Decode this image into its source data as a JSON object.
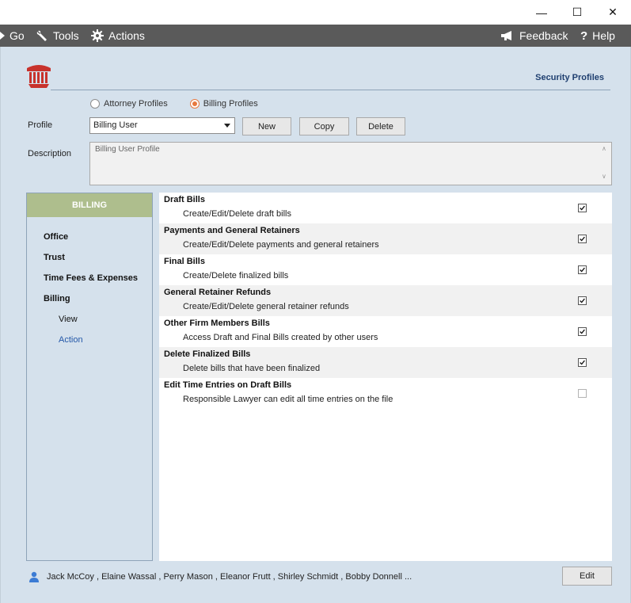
{
  "window": {
    "minimize_glyph": "—",
    "maximize_glyph": "☐",
    "close_glyph": "✕"
  },
  "menubar": {
    "go": "Go",
    "tools": "Tools",
    "actions": "Actions",
    "feedback": "Feedback",
    "help": "Help"
  },
  "header": {
    "section_title": "Security Profiles"
  },
  "profile_type": {
    "options": [
      "Attorney Profiles",
      "Billing Profiles"
    ],
    "selected": "Billing Profiles"
  },
  "form": {
    "profile_label": "Profile",
    "profile_value": "Billing User",
    "new_label": "New",
    "copy_label": "Copy",
    "delete_label": "Delete",
    "description_label": "Description",
    "description_value": "Billing User Profile"
  },
  "sidebar": {
    "header": "BILLING",
    "items": [
      {
        "label": "Office"
      },
      {
        "label": "Trust"
      },
      {
        "label": "Time Fees & Expenses"
      },
      {
        "label": "Billing"
      },
      {
        "label": "View"
      },
      {
        "label": "Action"
      }
    ]
  },
  "permissions": [
    {
      "title": "Draft Bills",
      "desc": "Create/Edit/Delete draft bills",
      "checked": true
    },
    {
      "title": "Payments and General Retainers",
      "desc": "Create/Edit/Delete payments and general retainers",
      "checked": true
    },
    {
      "title": "Final Bills",
      "desc": "Create/Delete finalized bills",
      "checked": true
    },
    {
      "title": "General Retainer Refunds",
      "desc": "Create/Edit/Delete general retainer refunds",
      "checked": true
    },
    {
      "title": "Other Firm Members Bills",
      "desc": "Access Draft and Final Bills created by other users",
      "checked": true
    },
    {
      "title": "Delete Finalized Bills",
      "desc": "Delete bills that have been finalized",
      "checked": true
    },
    {
      "title": "Edit Time Entries on Draft Bills",
      "desc": "Responsible Lawyer can edit all time entries on the file",
      "checked": false
    }
  ],
  "footer": {
    "users": "Jack McCoy , Elaine Wassal , Perry Mason , Eleanor Frutt , Shirley Schmidt , Bobby Donnell ...",
    "edit_label": "Edit"
  },
  "colors": {
    "menubar": "#5a5a5a",
    "background": "#d5e1ec",
    "sidebar_header": "#aebe8d",
    "accent_radio": "#e7793f",
    "logo_red": "#c8322c",
    "link": "#2458a8",
    "user_icon": "#3b7bd4"
  }
}
